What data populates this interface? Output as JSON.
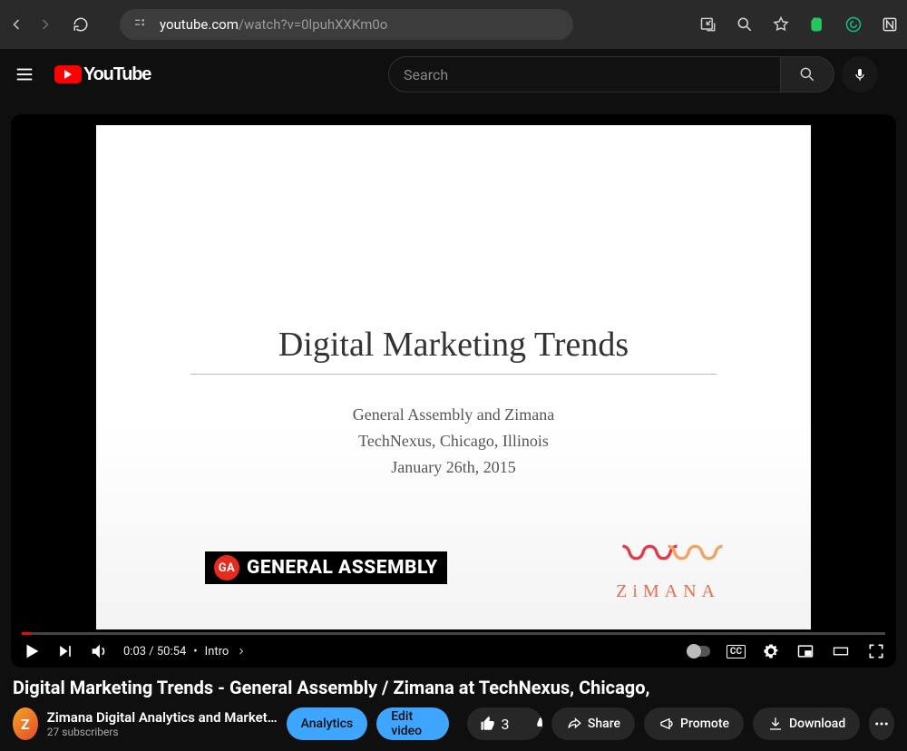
{
  "browser": {
    "url_domain": "youtube.com",
    "url_path": "/watch?v=0lpuhXXKm0o"
  },
  "header": {
    "search_placeholder": "Search",
    "logo_text": "YouTube"
  },
  "video": {
    "slide_title": "Digital Marketing Trends",
    "slide_line1": "General Assembly  and Zimana",
    "slide_line2": "TechNexus, Chicago, Illinois",
    "slide_line3": "January 26th, 2015",
    "ga_label": "GENERAL ASSEMBLY",
    "ga_badge": "GA",
    "zimana_label": "ZiMANA"
  },
  "player": {
    "time": "0:03 / 50:54",
    "chapter_prefix": "•",
    "chapter": "Intro",
    "cc_label": "CC"
  },
  "below": {
    "title": "Digital Marketing Trends - General Assembly / Zimana at TechNexus, Chicago,",
    "channel": "Zimana Digital Analytics and Market…",
    "subs": "27 subscribers",
    "analytics": "Analytics",
    "edit": "Edit video",
    "likes": "3",
    "share": "Share",
    "promote": "Promote",
    "download": "Download"
  }
}
